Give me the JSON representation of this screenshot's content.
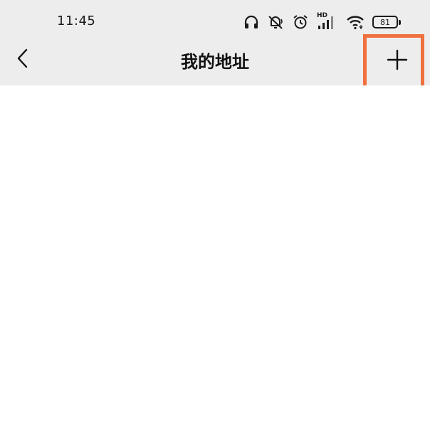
{
  "status_bar": {
    "time": "11:45",
    "network_label": "HD",
    "battery_level": "81",
    "icons": [
      "headphones-icon",
      "muted-bell-icon",
      "alarm-icon",
      "hd-signal-icon",
      "wifi-icon",
      "battery-icon"
    ]
  },
  "nav": {
    "title": "我的地址",
    "back_icon": "chevron-left-icon",
    "add_icon": "plus-icon"
  },
  "colors": {
    "top_background": "#ededed",
    "page_background": "#ffffff",
    "highlight": "#f0703e"
  }
}
